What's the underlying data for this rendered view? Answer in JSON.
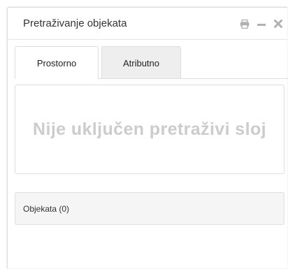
{
  "panel": {
    "title": "Pretraživanje objekata",
    "controls": [
      {
        "icon": "print-icon"
      },
      {
        "icon": "minimize-icon"
      },
      {
        "icon": "close-icon"
      }
    ]
  },
  "tabs": [
    {
      "label": "Prostorno",
      "active": true
    },
    {
      "label": "Atributno",
      "active": false
    }
  ],
  "notice": {
    "text": "Nije uključen pretraživi sloj"
  },
  "results": {
    "label": "Objekata (0)"
  },
  "colors": {
    "border": "#dddddd",
    "notice_text": "#cccccc",
    "inactive_tab_bg": "#eeeeee",
    "count_bar_bg": "#f5f5f5",
    "icon": "#b0b0b0"
  }
}
